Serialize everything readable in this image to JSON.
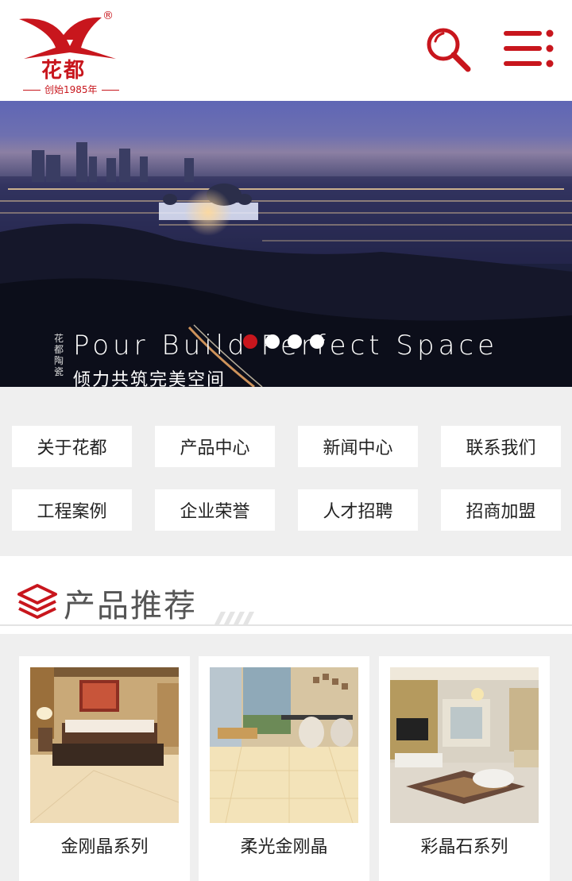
{
  "header": {
    "brand_name": "花都",
    "registered_mark": "®",
    "since_text": "创始1985年"
  },
  "banner": {
    "tagline_en": "Pour Build Perfect Space",
    "tagline_cn": "倾力共筑完美空间",
    "side_tag": "花都陶瓷",
    "slide_count": 4,
    "active_slide": 1
  },
  "nav": {
    "items": [
      {
        "label": "关于花都"
      },
      {
        "label": "产品中心"
      },
      {
        "label": "新闻中心"
      },
      {
        "label": "联系我们"
      },
      {
        "label": "工程案例"
      },
      {
        "label": "企业荣誉"
      },
      {
        "label": "人才招聘"
      },
      {
        "label": "招商加盟"
      }
    ]
  },
  "section": {
    "title": "产品推荐"
  },
  "products": [
    {
      "name": "金刚晶系列"
    },
    {
      "name": "柔光金刚晶"
    },
    {
      "name": "彩晶石系列"
    }
  ],
  "colors": {
    "brand_red": "#c8161d",
    "page_bg": "#efefef"
  }
}
